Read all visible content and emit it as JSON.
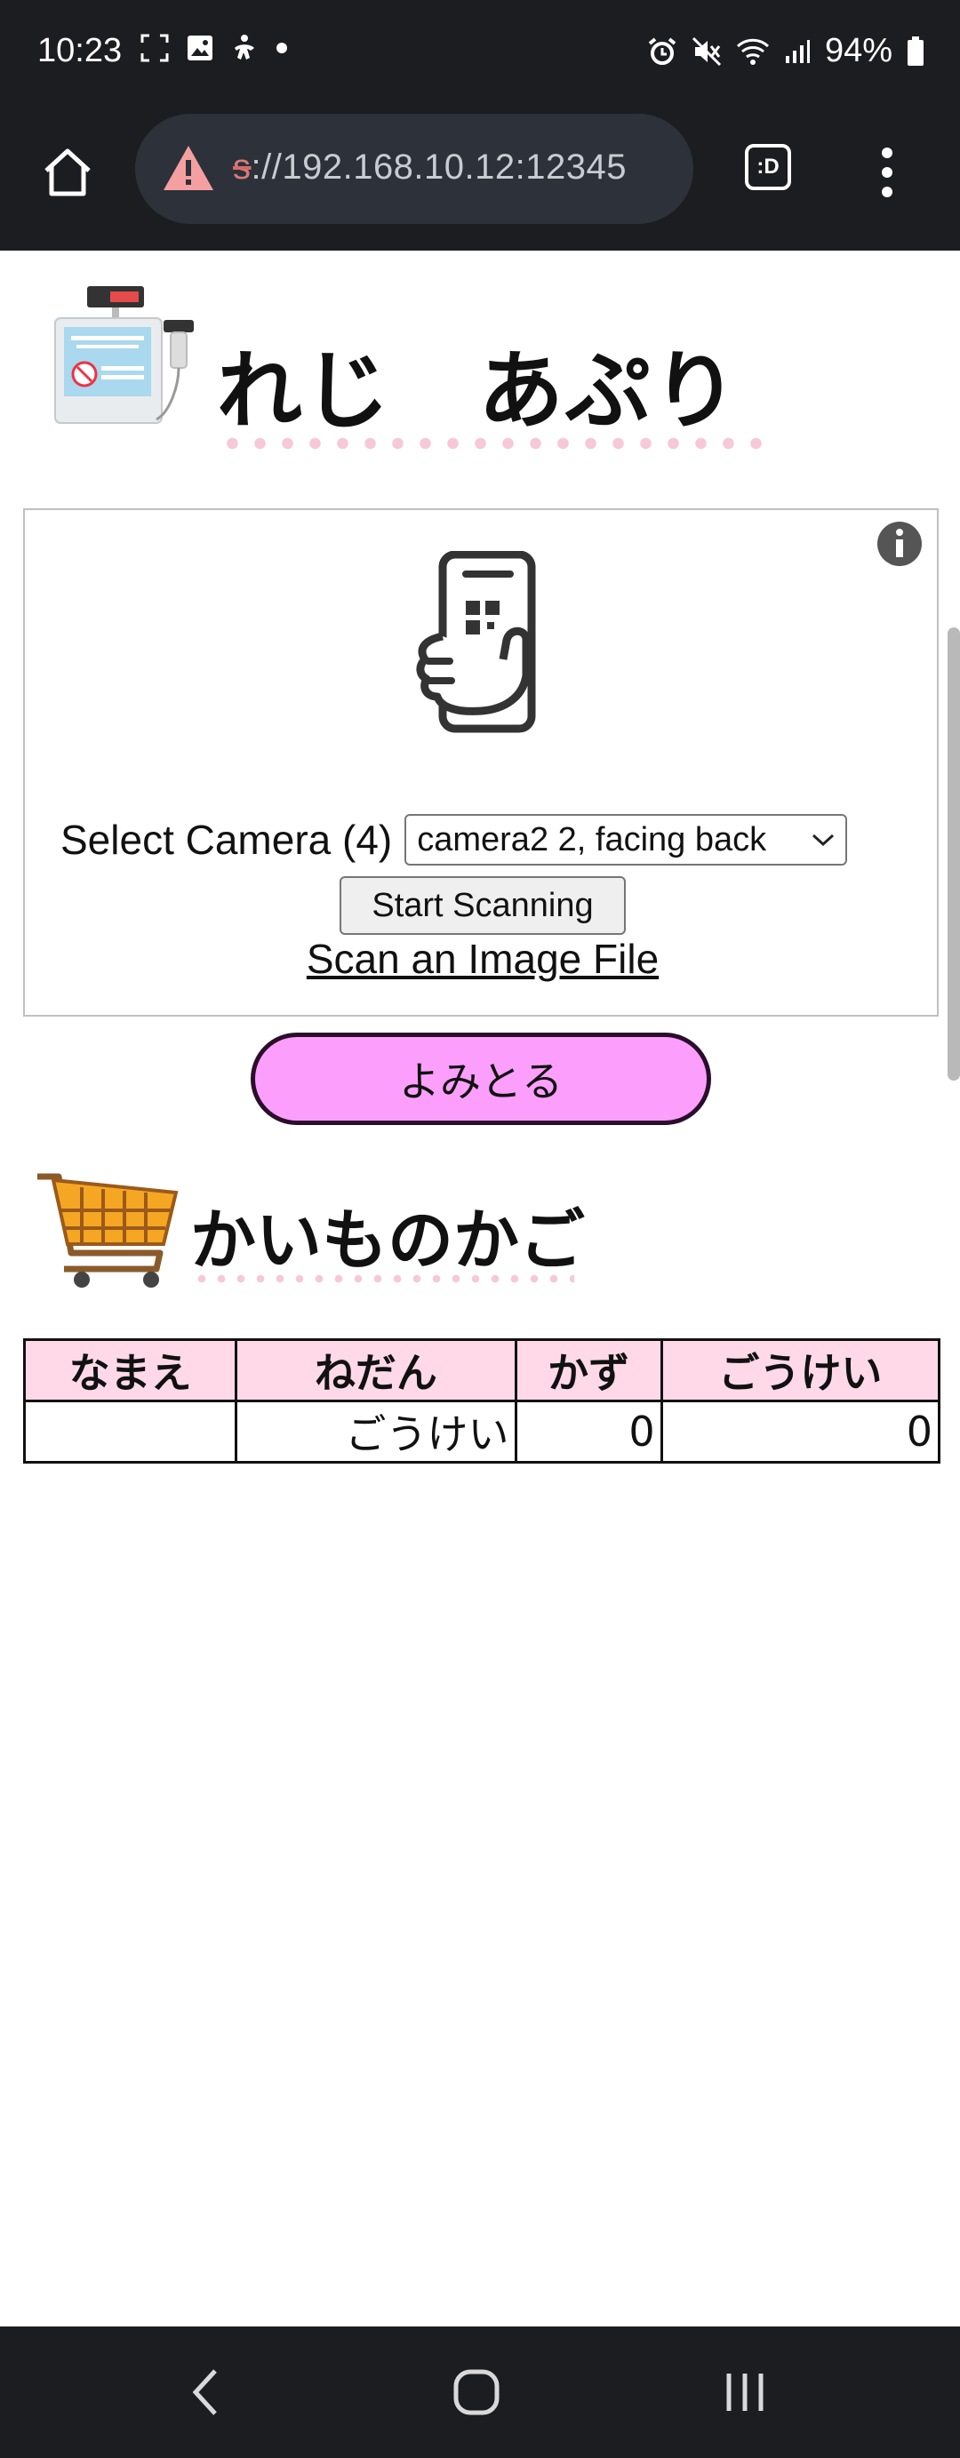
{
  "status_bar": {
    "time": "10:23",
    "battery": "94%",
    "left_icons": [
      "screenshot-icon",
      "gallery-icon",
      "accessibility-icon",
      "dot-icon"
    ],
    "right_icons": [
      "alarm-icon",
      "mute-icon",
      "wifi-icon",
      "signal-icon",
      "battery-icon"
    ]
  },
  "browser": {
    "url_scheme": "s",
    "url_rest": "://192.168.10.12:12345",
    "tabs_label": ":D"
  },
  "app": {
    "title": "れじ　あぷり"
  },
  "scanner": {
    "camera_label": "Select Camera (4)",
    "camera_selected": "camera2 2, facing back",
    "start_button": "Start Scanning",
    "scan_file_link": "Scan an Image File"
  },
  "read_button": "よみとる",
  "cart": {
    "title": "かいものかご",
    "columns": [
      "なまえ",
      "ねだん",
      "かず",
      "ごうけい"
    ],
    "total_row": {
      "name": "",
      "price": "ごうけい",
      "count": "0",
      "total": "0"
    }
  },
  "colors": {
    "read_button": "#fc9ffc",
    "table_header": "#ffd9e8",
    "system_bar": "#1c1d21",
    "url_warning": "#f4a0a0"
  }
}
